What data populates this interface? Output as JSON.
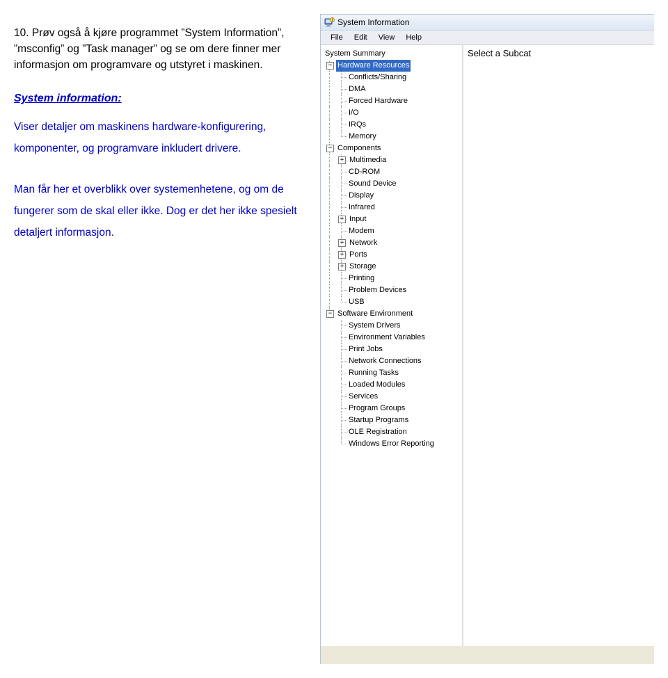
{
  "doc": {
    "task_number": "10.",
    "task_text_1": "Prøv også å kjøre programmet ",
    "task_text_2": "”System Information”, ”msconfig” og ”Task manager”",
    "task_text_3": "og se om dere finner mer informasjon om programvare og utstyret i maskinen.",
    "heading": "System information:",
    "para1": "Viser detaljer om maskinens hardware-konfigurering, komponenter, og programvare inkludert drivere.",
    "para2": "Man får her et overblikk over systemenhetene, og om de fungerer som de skal eller ikke. Dog er det her ikke spesielt detaljert informasjon."
  },
  "window": {
    "title": "System Information",
    "menu": {
      "file": "File",
      "edit": "Edit",
      "view": "View",
      "help": "Help"
    },
    "detail_text": "Select a Subcat"
  },
  "tree": {
    "root": "System Summary",
    "hw": {
      "label": "Hardware Resources",
      "items": [
        "Conflicts/Sharing",
        "DMA",
        "Forced Hardware",
        "I/O",
        "IRQs",
        "Memory"
      ]
    },
    "comp": {
      "label": "Components",
      "multimedia": "Multimedia",
      "items_a": [
        "CD-ROM",
        "Sound Device",
        "Display",
        "Infrared"
      ],
      "input": "Input",
      "items_b": [
        "Modem"
      ],
      "network": "Network",
      "ports": "Ports",
      "storage": "Storage",
      "items_c": [
        "Printing",
        "Problem Devices",
        "USB"
      ]
    },
    "sw": {
      "label": "Software Environment",
      "items": [
        "System Drivers",
        "Environment Variables",
        "Print Jobs",
        "Network Connections",
        "Running Tasks",
        "Loaded Modules",
        "Services",
        "Program Groups",
        "Startup Programs",
        "OLE Registration",
        "Windows Error Reporting"
      ]
    }
  }
}
